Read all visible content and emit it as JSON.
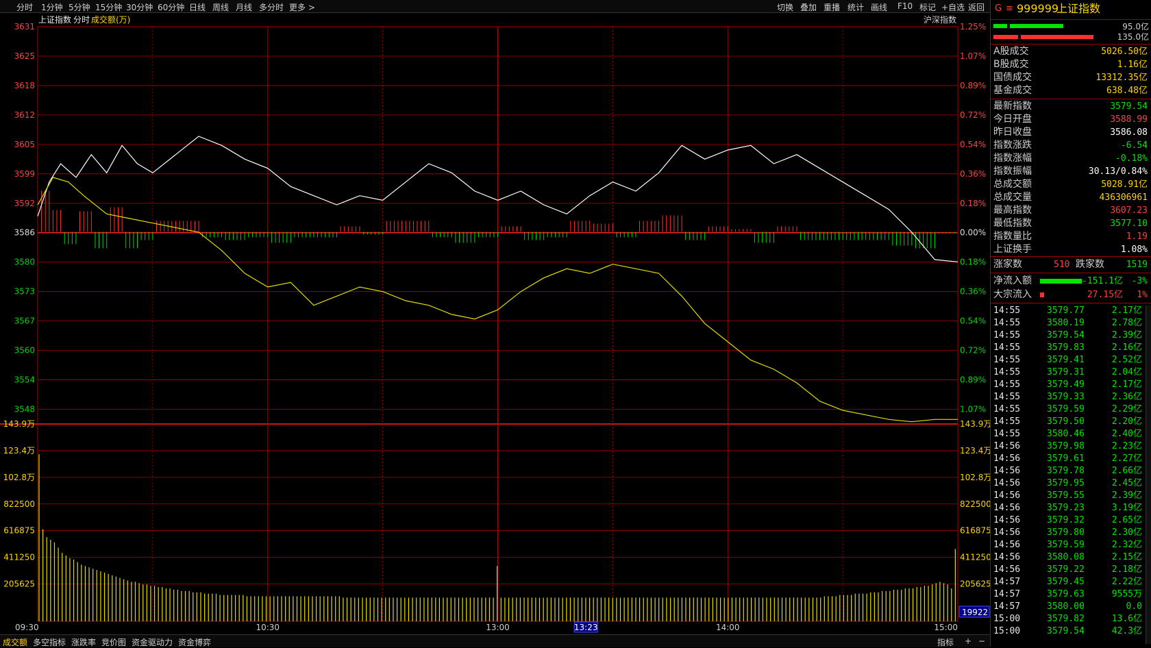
{
  "toolbar": {
    "periods": [
      "分时",
      "1分钟",
      "5分钟",
      "15分钟",
      "30分钟",
      "60分钟",
      "日线",
      "周线",
      "月线",
      "多分时",
      "更多 >"
    ],
    "active": "分时",
    "right_buttons": [
      "切换",
      "叠加",
      "重播",
      "统计",
      "画线",
      "F10",
      "标记",
      "+自选",
      "返回"
    ]
  },
  "chart_header": {
    "index_name": "上证指数",
    "mode": "分时",
    "volume_label": "成交额(万)",
    "market_button": "沪深指数"
  },
  "chart_data": {
    "type": "line",
    "title": "上证指数",
    "price_axis": {
      "ticks": [
        "3631",
        "3625",
        "3618",
        "3612",
        "3605",
        "3599",
        "3592",
        "3586",
        "3580",
        "3573",
        "3567",
        "3560",
        "3554",
        "3548"
      ],
      "pct_ticks": [
        "1.25%",
        "1.07%",
        "0.89%",
        "0.72%",
        "0.54%",
        "0.36%",
        "0.18%",
        "0.00%",
        "0.18%",
        "0.36%",
        "0.54%",
        "0.72%",
        "0.89%",
        "1.07%"
      ],
      "ylim": [
        3544,
        3631
      ],
      "prev_close": 3586.08
    },
    "time_axis": {
      "ticks": [
        "09:30",
        "10:30",
        "13:00",
        "14:00",
        "15:00"
      ],
      "cursor_label": "13:23",
      "minutes_total": 240
    },
    "series": [
      {
        "color": "#ffffff",
        "points": [
          [
            0,
            3589.5
          ],
          [
            3,
            3597
          ],
          [
            6,
            3601
          ],
          [
            10,
            3598
          ],
          [
            14,
            3603
          ],
          [
            18,
            3599
          ],
          [
            22,
            3605
          ],
          [
            26,
            3601
          ],
          [
            30,
            3599
          ],
          [
            36,
            3603
          ],
          [
            42,
            3607
          ],
          [
            48,
            3605
          ],
          [
            54,
            3602
          ],
          [
            60,
            3600
          ],
          [
            66,
            3596
          ],
          [
            72,
            3594
          ],
          [
            78,
            3592
          ],
          [
            84,
            3594
          ],
          [
            90,
            3593
          ],
          [
            96,
            3597
          ],
          [
            102,
            3601
          ],
          [
            108,
            3599
          ],
          [
            114,
            3595
          ],
          [
            120,
            3593
          ],
          [
            126,
            3595
          ],
          [
            132,
            3592
          ],
          [
            138,
            3590
          ],
          [
            144,
            3594
          ],
          [
            150,
            3597
          ],
          [
            156,
            3595
          ],
          [
            162,
            3599
          ],
          [
            168,
            3605
          ],
          [
            174,
            3602
          ],
          [
            180,
            3604
          ],
          [
            186,
            3605
          ],
          [
            192,
            3601
          ],
          [
            198,
            3603
          ],
          [
            204,
            3600
          ],
          [
            210,
            3597
          ],
          [
            216,
            3594
          ],
          [
            222,
            3591
          ],
          [
            228,
            3586
          ],
          [
            234,
            3580
          ],
          [
            240,
            3579.5
          ]
        ]
      },
      {
        "color": "#e6dc00",
        "points": [
          [
            0,
            3592
          ],
          [
            4,
            3598
          ],
          [
            8,
            3597
          ],
          [
            12,
            3594
          ],
          [
            18,
            3590
          ],
          [
            24,
            3589
          ],
          [
            30,
            3588
          ],
          [
            36,
            3587
          ],
          [
            42,
            3586
          ],
          [
            48,
            3582
          ],
          [
            54,
            3577
          ],
          [
            60,
            3574
          ],
          [
            66,
            3575
          ],
          [
            72,
            3570
          ],
          [
            78,
            3572
          ],
          [
            84,
            3574
          ],
          [
            90,
            3573
          ],
          [
            96,
            3571
          ],
          [
            102,
            3570
          ],
          [
            108,
            3568
          ],
          [
            114,
            3567
          ],
          [
            120,
            3569
          ],
          [
            126,
            3573
          ],
          [
            132,
            3576
          ],
          [
            138,
            3578
          ],
          [
            144,
            3577
          ],
          [
            150,
            3579
          ],
          [
            156,
            3578
          ],
          [
            162,
            3577
          ],
          [
            168,
            3572
          ],
          [
            174,
            3566
          ],
          [
            180,
            3562
          ],
          [
            186,
            3558
          ],
          [
            192,
            3556
          ],
          [
            198,
            3553
          ],
          [
            204,
            3549
          ],
          [
            210,
            3547
          ],
          [
            216,
            3546
          ],
          [
            222,
            3545
          ],
          [
            228,
            3544.5
          ],
          [
            234,
            3545
          ],
          [
            240,
            3545
          ]
        ]
      }
    ],
    "volume_axis": {
      "ticks": [
        "143.9万",
        "123.4万",
        "102.8万",
        "822500",
        "616875",
        "411250",
        "205625"
      ],
      "ylim": [
        0,
        1439000
      ],
      "current_value": "19922"
    },
    "volume_series": {
      "color": "#e6dc00",
      "values": [
        1270000,
        700000,
        640000,
        620000,
        600000,
        560000,
        520000,
        500000,
        480000,
        470000,
        450000,
        430000,
        420000,
        410000,
        400000,
        390000,
        380000,
        370000,
        360000,
        350000,
        340000,
        330000,
        320000,
        310000,
        300000,
        300000,
        290000,
        280000,
        280000,
        270000,
        270000,
        260000,
        260000,
        250000,
        250000,
        240000,
        240000,
        230000,
        230000,
        230000,
        220000,
        220000,
        220000,
        210000,
        210000,
        210000,
        210000,
        200000,
        200000,
        200000,
        200000,
        200000,
        200000,
        200000,
        190000,
        190000,
        190000,
        190000,
        190000,
        190000,
        190000,
        190000,
        190000,
        190000,
        190000,
        190000,
        190000,
        190000,
        190000,
        190000,
        190000,
        190000,
        190000,
        190000,
        190000,
        190000,
        190000,
        190000,
        190000,
        180000,
        180000,
        180000,
        180000,
        180000,
        180000,
        180000,
        180000,
        180000,
        180000,
        180000,
        180000,
        180000,
        180000,
        180000,
        180000,
        180000,
        180000,
        180000,
        180000,
        180000,
        180000,
        180000,
        180000,
        180000,
        180000,
        180000,
        180000,
        180000,
        180000,
        180000,
        180000,
        180000,
        180000,
        180000,
        180000,
        180000,
        180000,
        180000,
        180000,
        420000,
        180000,
        180000,
        180000,
        180000,
        180000,
        180000,
        180000,
        180000,
        180000,
        180000,
        180000,
        180000,
        180000,
        180000,
        180000,
        180000,
        180000,
        180000,
        180000,
        180000,
        180000,
        180000,
        180000,
        180000,
        180000,
        180000,
        180000,
        180000,
        180000,
        180000,
        180000,
        180000,
        180000,
        180000,
        180000,
        180000,
        180000,
        180000,
        180000,
        180000,
        180000,
        180000,
        180000,
        180000,
        180000,
        180000,
        180000,
        180000,
        180000,
        180000,
        180000,
        180000,
        180000,
        180000,
        180000,
        180000,
        180000,
        180000,
        180000,
        180000,
        180000,
        180000,
        180000,
        180000,
        180000,
        180000,
        180000,
        180000,
        180000,
        180000,
        180000,
        180000,
        180000,
        180000,
        180000,
        180000,
        180000,
        180000,
        180000,
        180000,
        180000,
        180000,
        180000,
        180000,
        190000,
        190000,
        190000,
        190000,
        200000,
        200000,
        200000,
        200000,
        210000,
        210000,
        210000,
        210000,
        220000,
        220000,
        220000,
        230000,
        230000,
        230000,
        240000,
        240000,
        240000,
        250000,
        250000,
        250000,
        260000,
        260000,
        270000,
        270000,
        280000,
        290000,
        300000,
        290000,
        280000,
        250000,
        550000
      ]
    }
  },
  "right_panel": {
    "code_prefix": "G",
    "menu_icon": "≡",
    "code": "999999",
    "name": "上证指数",
    "bar_top_value": "95.0亿",
    "bar_bottom_value": "135.0亿",
    "turnover": [
      {
        "label": "A股成交",
        "value": "5026.50亿",
        "color": "#ffd400"
      },
      {
        "label": "B股成交",
        "value": "1.16亿",
        "color": "#ffd400"
      },
      {
        "label": "国债成交",
        "value": "13312.35亿",
        "color": "#ffd400"
      },
      {
        "label": "基金成交",
        "value": "638.48亿",
        "color": "#ffd400"
      }
    ],
    "quote": [
      {
        "label": "最新指数",
        "value": "3579.54",
        "color": "#00e600"
      },
      {
        "label": "今日开盘",
        "value": "3588.99",
        "color": "#ff4040"
      },
      {
        "label": "昨日收盘",
        "value": "3586.08",
        "color": "#ffffff"
      },
      {
        "label": "指数涨跌",
        "value": "-6.54",
        "color": "#00e600"
      },
      {
        "label": "指数涨幅",
        "value": "-0.18%",
        "color": "#00e600"
      },
      {
        "label": "指数振幅",
        "value": "30.13/0.84%",
        "color": "#ffffff"
      },
      {
        "label": "总成交额",
        "value": "5028.91亿",
        "color": "#ffd400"
      },
      {
        "label": "总成交量",
        "value": "436306961",
        "color": "#ffd400"
      },
      {
        "label": "最高指数",
        "value": "3607.23",
        "color": "#ff4040"
      },
      {
        "label": "最低指数",
        "value": "3577.10",
        "color": "#00e600"
      },
      {
        "label": "指数量比",
        "value": "1.19",
        "color": "#ff4040"
      },
      {
        "label": "上证换手",
        "value": "1.08%",
        "color": "#ffffff"
      }
    ],
    "breadth": {
      "up_label": "涨家数",
      "up_value": "510",
      "down_label": "跌家数",
      "down_value": "1519"
    },
    "flows": [
      {
        "label": "净流入额",
        "value": "-151.1亿",
        "pct": "-3%",
        "bar_color": "#00e600",
        "val_color": "#00e600",
        "bar_frac": 0.55
      },
      {
        "label": "大宗流入",
        "value": "27.15亿",
        "pct": "1%",
        "bar_color": "#ff3030",
        "val_color": "#ff4040",
        "bar_frac": 0.05
      }
    ],
    "ticks": [
      {
        "time": "14:55",
        "price": "3579.77",
        "amount": "2.17亿"
      },
      {
        "time": "14:55",
        "price": "3580.19",
        "amount": "2.78亿"
      },
      {
        "time": "14:55",
        "price": "3579.54",
        "amount": "2.39亿"
      },
      {
        "time": "14:55",
        "price": "3579.83",
        "amount": "2.16亿"
      },
      {
        "time": "14:55",
        "price": "3579.41",
        "amount": "2.52亿"
      },
      {
        "time": "14:55",
        "price": "3579.31",
        "amount": "2.04亿"
      },
      {
        "time": "14:55",
        "price": "3579.49",
        "amount": "2.17亿"
      },
      {
        "time": "14:55",
        "price": "3579.33",
        "amount": "2.36亿"
      },
      {
        "time": "14:55",
        "price": "3579.59",
        "amount": "2.29亿"
      },
      {
        "time": "14:55",
        "price": "3579.50",
        "amount": "2.20亿"
      },
      {
        "time": "14:55",
        "price": "3580.46",
        "amount": "2.40亿"
      },
      {
        "time": "14:56",
        "price": "3579.98",
        "amount": "2.23亿"
      },
      {
        "time": "14:56",
        "price": "3579.61",
        "amount": "2.27亿"
      },
      {
        "time": "14:56",
        "price": "3579.78",
        "amount": "2.66亿"
      },
      {
        "time": "14:56",
        "price": "3579.95",
        "amount": "2.45亿"
      },
      {
        "time": "14:56",
        "price": "3579.55",
        "amount": "2.39亿"
      },
      {
        "time": "14:56",
        "price": "3579.23",
        "amount": "3.19亿"
      },
      {
        "time": "14:56",
        "price": "3579.32",
        "amount": "2.65亿"
      },
      {
        "time": "14:56",
        "price": "3579.80",
        "amount": "2.30亿"
      },
      {
        "time": "14:56",
        "price": "3579.59",
        "amount": "2.32亿"
      },
      {
        "time": "14:56",
        "price": "3580.08",
        "amount": "2.15亿"
      },
      {
        "time": "14:56",
        "price": "3579.22",
        "amount": "2.18亿"
      },
      {
        "time": "14:57",
        "price": "3579.45",
        "amount": "2.22亿"
      },
      {
        "time": "14:57",
        "price": "3579.63",
        "amount": "9555万"
      },
      {
        "time": "14:57",
        "price": "3580.00",
        "amount": "0.0"
      },
      {
        "time": "15:00",
        "price": "3579.82",
        "amount": "13.6亿"
      },
      {
        "time": "15:00",
        "price": "3579.54",
        "amount": "42.3亿"
      }
    ]
  },
  "bottom_tabs": [
    "成交额",
    "多空指标",
    "涨跌率",
    "竞价图",
    "资金驱动力",
    "资金博弈"
  ],
  "bottom_active": "成交额",
  "bottom_right": [
    "指标",
    "+",
    "−"
  ]
}
